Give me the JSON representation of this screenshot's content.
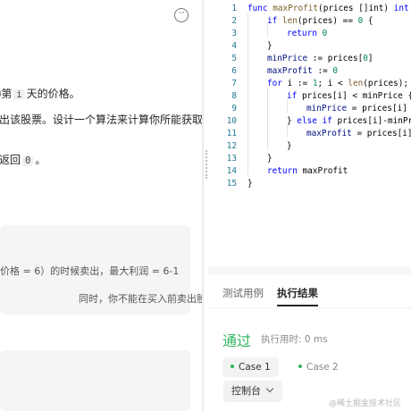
{
  "description": {
    "line1": {
      "pre": "ǿ第",
      "code": "i",
      "post": "天的价格。"
    },
    "line2": "出该股票。设计一个算法来计算你所能获取",
    "line3": {
      "pre": "返回",
      "code": "0",
      "post": "。"
    }
  },
  "example": {
    "line1": "价格 = 6）的时候卖出，最大利润 = 6-1",
    "line2": "同时，你不能在买入前卖出股票。"
  },
  "editor": {
    "lines": [
      {
        "no": "1",
        "indent": 0,
        "tokens": [
          {
            "t": "func ",
            "c": "kw"
          },
          {
            "t": "maxProfit",
            "c": "fn"
          },
          {
            "t": "(prices []int) ",
            "c": ""
          },
          {
            "t": "int",
            "c": "kw"
          },
          {
            "t": " {",
            "c": ""
          }
        ]
      },
      {
        "no": "2",
        "indent": 1,
        "tokens": [
          {
            "t": "if ",
            "c": "kw"
          },
          {
            "t": "len",
            "c": "fn"
          },
          {
            "t": "(prices) == ",
            "c": ""
          },
          {
            "t": "0",
            "c": "num"
          },
          {
            "t": " {",
            "c": ""
          }
        ]
      },
      {
        "no": "3",
        "indent": 2,
        "tokens": [
          {
            "t": "return ",
            "c": "kw"
          },
          {
            "t": "0",
            "c": "num"
          }
        ]
      },
      {
        "no": "4",
        "indent": 1,
        "tokens": [
          {
            "t": "}",
            "c": ""
          }
        ]
      },
      {
        "no": "5",
        "indent": 1,
        "tokens": [
          {
            "t": "minPrice",
            "c": "var"
          },
          {
            "t": " := prices[",
            "c": ""
          },
          {
            "t": "0",
            "c": "num"
          },
          {
            "t": "]",
            "c": ""
          }
        ]
      },
      {
        "no": "6",
        "indent": 1,
        "tokens": [
          {
            "t": "maxProfit",
            "c": "var"
          },
          {
            "t": " := ",
            "c": ""
          },
          {
            "t": "0",
            "c": "num"
          }
        ]
      },
      {
        "no": "7",
        "indent": 1,
        "tokens": [
          {
            "t": "for ",
            "c": "kw"
          },
          {
            "t": "i := ",
            "c": ""
          },
          {
            "t": "1",
            "c": "num"
          },
          {
            "t": "; i < ",
            "c": ""
          },
          {
            "t": "len",
            "c": "fn"
          },
          {
            "t": "(prices); i",
            "c": ""
          }
        ]
      },
      {
        "no": "8",
        "indent": 2,
        "tokens": [
          {
            "t": "if ",
            "c": "kw"
          },
          {
            "t": "prices[i] < minPrice {",
            "c": ""
          }
        ]
      },
      {
        "no": "9",
        "indent": 3,
        "tokens": [
          {
            "t": "minPrice",
            "c": "var"
          },
          {
            "t": " = prices[i]",
            "c": ""
          }
        ]
      },
      {
        "no": "10",
        "indent": 2,
        "tokens": [
          {
            "t": "} ",
            "c": ""
          },
          {
            "t": "else if ",
            "c": "kw"
          },
          {
            "t": "prices[i]-minPri",
            "c": ""
          }
        ]
      },
      {
        "no": "11",
        "indent": 3,
        "tokens": [
          {
            "t": "maxProfit",
            "c": "var"
          },
          {
            "t": " = prices[i]",
            "c": ""
          }
        ]
      },
      {
        "no": "12",
        "indent": 2,
        "tokens": [
          {
            "t": "}",
            "c": ""
          }
        ]
      },
      {
        "no": "13",
        "indent": 1,
        "tokens": [
          {
            "t": "}",
            "c": ""
          }
        ]
      },
      {
        "no": "14",
        "indent": 1,
        "tokens": [
          {
            "t": "return ",
            "c": "kw"
          },
          {
            "t": "maxProfit",
            "c": ""
          }
        ]
      },
      {
        "no": "15",
        "indent": 0,
        "tokens": [
          {
            "t": "}",
            "c": ""
          }
        ]
      }
    ]
  },
  "result": {
    "tabs": {
      "testcases": "测试用例",
      "result": "执行结果"
    },
    "status": "通过",
    "runtime": "执行用时: 0 ms",
    "cases": [
      "Case 1",
      "Case 2"
    ],
    "console": "控制台",
    "watermark": "@稀土掘金技术社区"
  },
  "colors": {
    "accent": "#2db55d",
    "keyword": "#0000ff",
    "function": "#795e26",
    "number": "#098658",
    "variable": "#001080"
  }
}
